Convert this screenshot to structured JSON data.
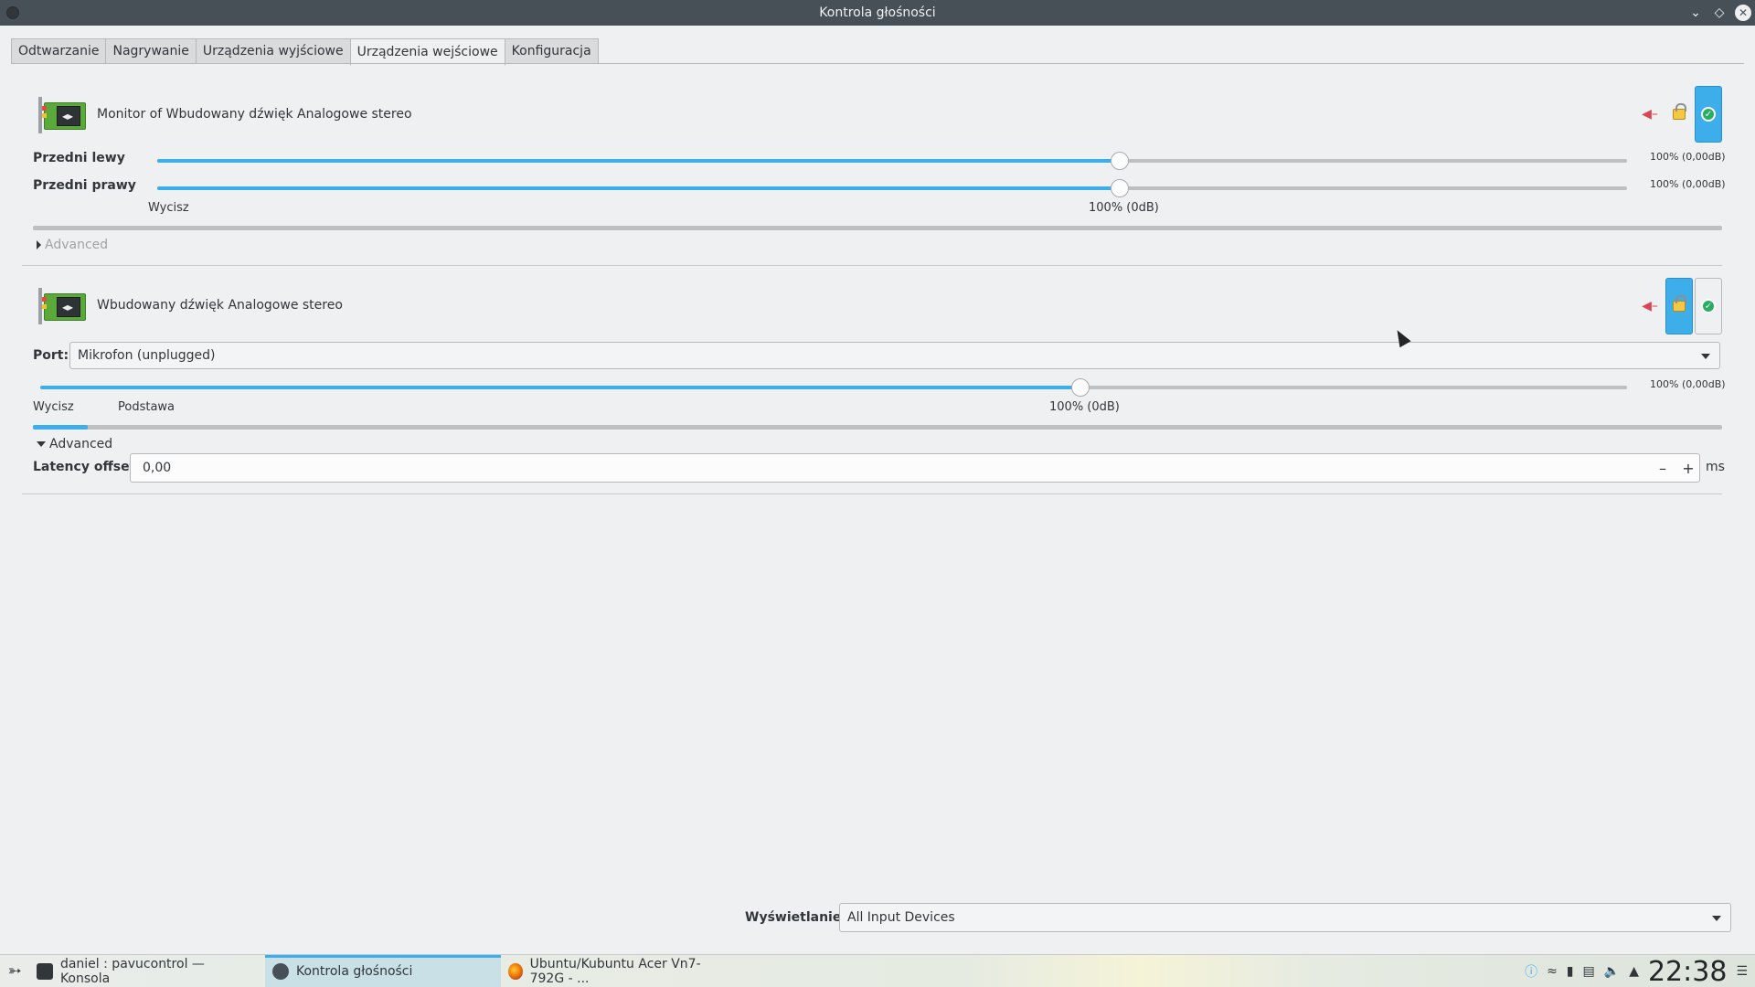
{
  "window": {
    "title": "Kontrola głośności"
  },
  "tabs": [
    {
      "label": "Odtwarzanie",
      "active": false
    },
    {
      "label": "Nagrywanie",
      "active": false
    },
    {
      "label": "Urządzenia wyjściowe",
      "active": false
    },
    {
      "label": "Urządzenia wejściowe",
      "active": true
    },
    {
      "label": "Konfiguracja",
      "active": false
    }
  ],
  "devices": [
    {
      "name": "Monitor of Wbudowany dźwięk Analogowe stereo",
      "channels": [
        {
          "label": "Przedni lewy",
          "percent": 100,
          "value": "100% (0,00dB)"
        },
        {
          "label": "Przedni prawy",
          "percent": 100,
          "value": "100% (0,00dB)"
        }
      ],
      "scale": {
        "silence": "Wycisz",
        "base": "",
        "norm": "100% (0dB)"
      },
      "level_percent": 0,
      "advanced_label": "Advanced",
      "buttons": {
        "mute": false,
        "lock": false,
        "default": true
      }
    },
    {
      "name": "Wbudowany dźwięk Analogowe stereo",
      "port_label": "Port:",
      "port_value": "Mikrofon (unplugged)",
      "channels": [
        {
          "label": "",
          "percent": 100,
          "value": "100% (0,00dB)"
        }
      ],
      "scale": {
        "silence": "Wycisz",
        "base": "Podstawa",
        "norm": "100% (0dB)"
      },
      "level_percent": 3,
      "advanced_label": "Advanced",
      "latency_label": "Latency offset:",
      "latency_value": "0,00",
      "latency_unit": "ms",
      "buttons": {
        "mute": false,
        "lock": true,
        "default": false
      }
    }
  ],
  "footer": {
    "show_label": "Wyświetlanie:",
    "show_value": "All Input Devices"
  },
  "taskbar": {
    "tasks": [
      {
        "label": "daniel : pavucontrol — Konsola",
        "active": false
      },
      {
        "label": "Kontrola głośności",
        "active": true
      },
      {
        "label": "Ubuntu/Kubuntu Acer Vn7-792G - ...",
        "active": false
      }
    ],
    "clock": "22:38"
  },
  "colors": {
    "accent": "#3daee9",
    "titlebar": "#475057",
    "background": "#eff0f1"
  }
}
